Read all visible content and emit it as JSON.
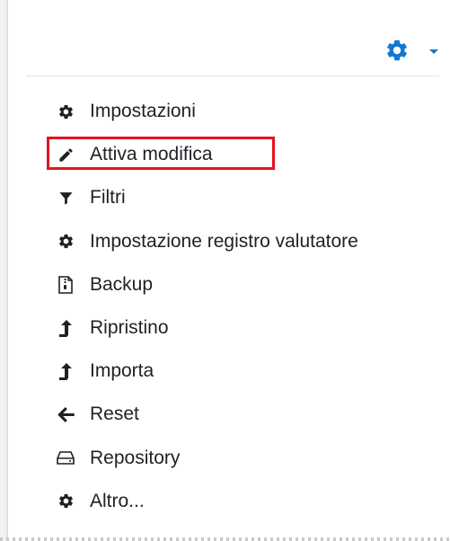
{
  "colors": {
    "accent": "#1177d1",
    "icon": "#1d2125",
    "highlight": "#e3141f"
  },
  "header": {
    "gear_icon": "gear-icon",
    "caret_icon": "caret-down-icon"
  },
  "menu": {
    "items": [
      {
        "label": "Impostazioni",
        "icon": "gear-icon"
      },
      {
        "label": "Attiva modifica",
        "icon": "pencil-icon",
        "highlighted": true
      },
      {
        "label": "Filtri",
        "icon": "filter-icon"
      },
      {
        "label": "Impostazione registro valutatore",
        "icon": "gear-icon"
      },
      {
        "label": "Backup",
        "icon": "file-archive-icon"
      },
      {
        "label": "Ripristino",
        "icon": "level-up-icon"
      },
      {
        "label": "Importa",
        "icon": "level-up-icon"
      },
      {
        "label": "Reset",
        "icon": "arrow-left-icon"
      },
      {
        "label": "Repository",
        "icon": "hdd-icon"
      },
      {
        "label": "Altro...",
        "icon": "gear-icon"
      }
    ]
  }
}
